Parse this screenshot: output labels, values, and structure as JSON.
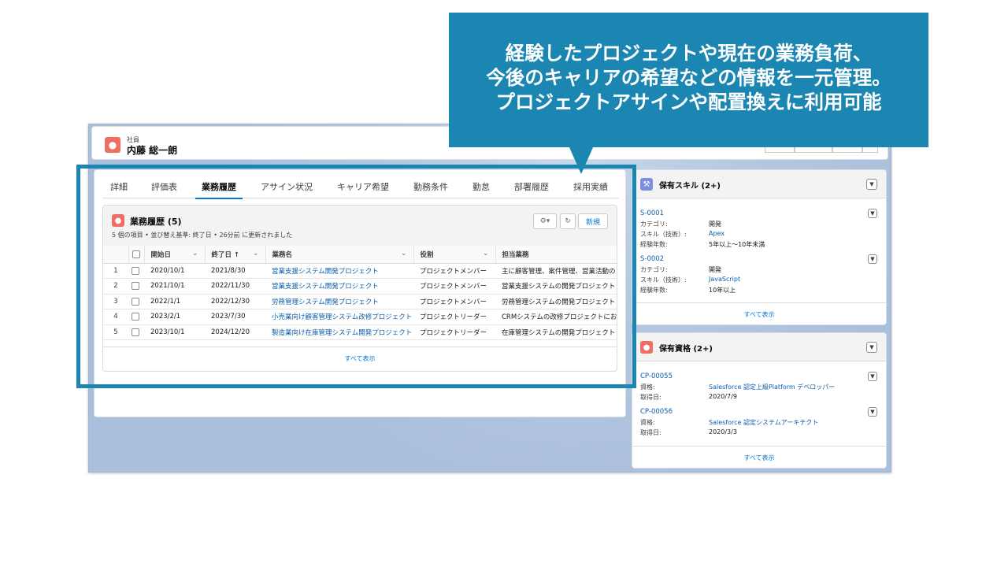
{
  "header": {
    "object_type": "社員",
    "record_name": "内藤 総一朗"
  },
  "tabs": [
    "詳細",
    "評価表",
    "業務履歴",
    "アサイン状況",
    "キャリア希望",
    "勤務条件",
    "勤怠",
    "部署履歴",
    "採用実績"
  ],
  "active_tab": "業務履歴",
  "work_history": {
    "title": "業務履歴 (5)",
    "meta": "5 個の項目 • 並び替え基準: 終了日 • 26分前 に更新されました",
    "settings_icon": "gear-icon",
    "refresh_icon": "refresh-icon",
    "new_label": "新規",
    "columns": [
      "開始日",
      "終了日 ↑",
      "業務名",
      "役割",
      "担当業務"
    ],
    "rows": [
      {
        "n": "1",
        "start": "2020/10/1",
        "end": "2021/8/30",
        "name": "営業支援システム開発プロジェクト",
        "role": "プロジェクトメンバー",
        "duty": "主に顧客管理、案件管理、営業活動の"
      },
      {
        "n": "2",
        "start": "2021/10/1",
        "end": "2022/11/30",
        "name": "営業支援システム開発プロジェクト",
        "role": "プロジェクトメンバー",
        "duty": "営業支援システムの開発プロジェクト"
      },
      {
        "n": "3",
        "start": "2022/1/1",
        "end": "2022/12/30",
        "name": "労務管理システム開発プロジェクト",
        "role": "プロジェクトメンバー",
        "duty": "労務管理システムの開発プロジェクト"
      },
      {
        "n": "4",
        "start": "2023/2/1",
        "end": "2023/7/30",
        "name": "小売業向け顧客管理システム改修プロジェクト",
        "role": "プロジェクトリーダー",
        "duty": "CRMシステムの改修プロジェクトにお"
      },
      {
        "n": "5",
        "start": "2023/10/1",
        "end": "2024/12/20",
        "name": "製造業向け在庫管理システム開発プロジェクト",
        "role": "プロジェクトリーダー",
        "duty": "在庫管理システムの開発プロジェクト"
      }
    ],
    "view_all": "すべて表示"
  },
  "skills": {
    "title": "保有スキル (2+)",
    "icon": "wrench-icon",
    "records": [
      {
        "id": "S-0001",
        "category_label": "カテゴリ:",
        "category": "開発",
        "skill_label": "スキル（技術）:",
        "skill": "Apex",
        "years_label": "経験年数:",
        "years": "5年以上～10年未満"
      },
      {
        "id": "S-0002",
        "category_label": "カテゴリ:",
        "category": "開発",
        "skill_label": "スキル（技術）:",
        "skill": "JavaScript",
        "years_label": "経験年数:",
        "years": "10年以上"
      }
    ],
    "view_all": "すべて表示"
  },
  "certs": {
    "title": "保有資格 (2+)",
    "icon": "person-icon",
    "records": [
      {
        "id": "CP-00055",
        "cert_label": "資格:",
        "cert": "Salesforce 認定上級Platform デベロッパー",
        "date_label": "取得日:",
        "date": "2020/7/9"
      },
      {
        "id": "CP-00056",
        "cert_label": "資格:",
        "cert": "Salesforce 認定システムアーキテクト",
        "date_label": "取得日:",
        "date": "2020/3/3"
      }
    ],
    "view_all": "すべて表示"
  },
  "callout": {
    "line1": "経験したプロジェクトや現在の業務負荷、",
    "line2": "今後のキャリアの希望などの情報を一元管理。",
    "line3": "プロジェクトアサインや配置換えに利用可能"
  },
  "colors": {
    "accent": "#1c86b2",
    "brand_blue": "#0176d3",
    "record_icon": "#ef6e64",
    "skill_icon": "#7f8de1"
  }
}
